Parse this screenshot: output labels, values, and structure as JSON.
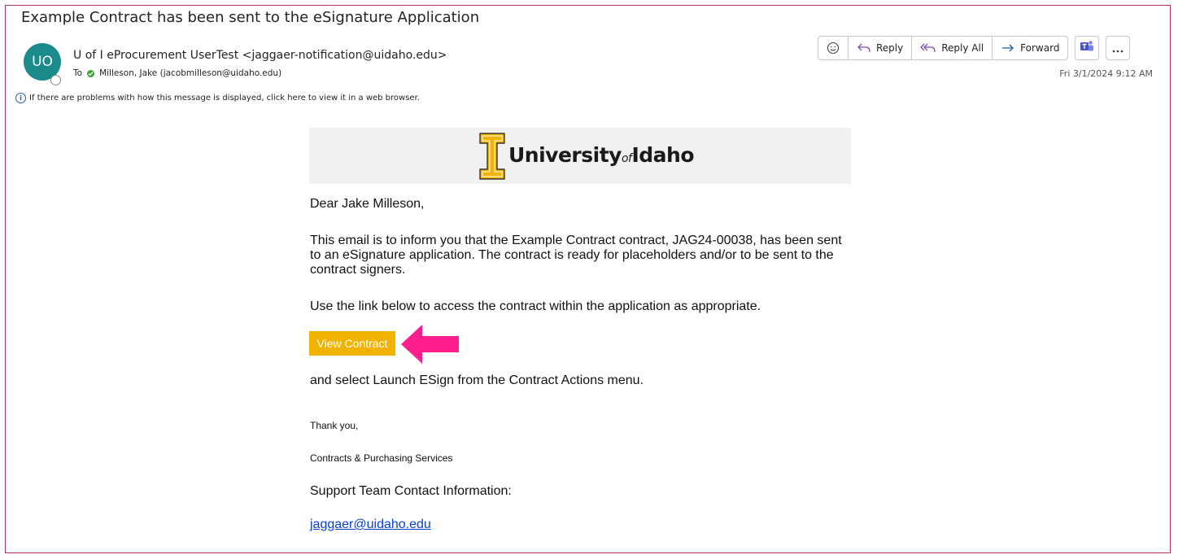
{
  "email": {
    "subject": "Example Contract has been sent to the eSignature Application",
    "avatar_initials": "UO",
    "sender": "U of I eProcurement UserTest <jaggaer-notification@uidaho.edu>",
    "to_label": "To",
    "recipient": "Milleson, Jake (jacobmilleson@uidaho.edu)",
    "info_notice": "If there are problems with how this message is displayed, click here to view it in a web browser.",
    "date": "Fri 3/1/2024 9:12 AM"
  },
  "toolbar": {
    "emoji_icon": "smiley-icon",
    "reply_label": "Reply",
    "reply_all_label": "Reply All",
    "forward_label": "Forward",
    "teams_icon": "teams-icon",
    "more_icon": "more-icon"
  },
  "banner": {
    "logo_university": "University",
    "logo_of": "of",
    "logo_idaho": "Idaho",
    "logo_color": "#f1b300"
  },
  "message": {
    "greeting": "Dear Jake Milleson,",
    "paragraph1": "This email is to inform you that the Example Contract contract, JAG24-00038, has been sent to an eSignature application. The contract is ready for placeholders and/or to be sent to the contract signers.",
    "paragraph2": "Use the link below to access the contract within the application as appropriate.",
    "view_button": "View Contract",
    "after_button": "and select Launch ESign from the Contract Actions menu.",
    "thanks": "Thank you,",
    "signature": "Contracts & Purchasing Services",
    "support_heading": "Support Team Contact Information:",
    "support_email": "jaggaer@uidaho.edu"
  },
  "colors": {
    "frame_border": "#b3305f",
    "avatar_bg": "#1b8a8a",
    "button_bg": "#f1b300",
    "arrow": "#ff1e8e",
    "link": "#0b40d6"
  }
}
